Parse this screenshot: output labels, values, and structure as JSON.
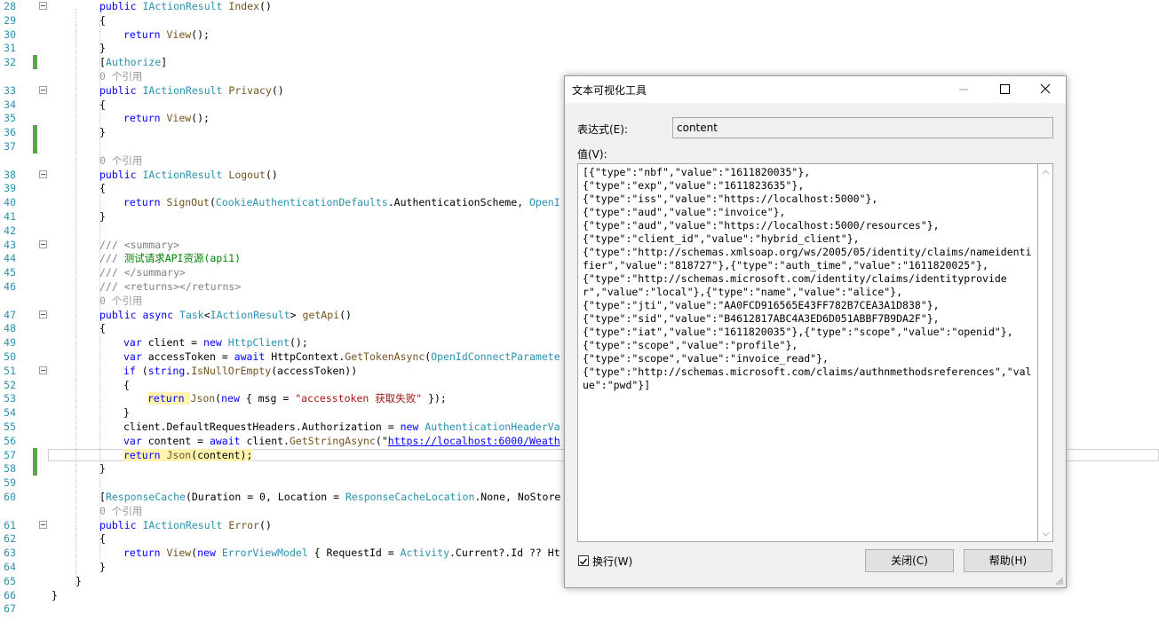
{
  "editor": {
    "lines": [
      {
        "n": "28",
        "fold": true,
        "segs": [
          [
            "kw",
            "public "
          ],
          [
            "ty",
            "IActionResult "
          ],
          [
            "me",
            "Index"
          ],
          [
            "",
            "()"
          ]
        ],
        "ind": 2
      },
      {
        "n": "29",
        "segs": [
          [
            "",
            "{"
          ]
        ],
        "ind": 2
      },
      {
        "n": "30",
        "segs": [
          [
            "kw",
            "return "
          ],
          [
            "me",
            "View"
          ],
          [
            "",
            "();"
          ]
        ],
        "ind": 3
      },
      {
        "n": "31",
        "segs": [
          [
            "",
            "}"
          ]
        ],
        "ind": 2
      },
      {
        "n": "32",
        "chg": true,
        "segs": [
          [
            "",
            "["
          ],
          [
            "ty",
            "Authorize"
          ],
          [
            "",
            "]"
          ]
        ],
        "ind": 2
      },
      {
        "n": "",
        "segs": [
          [
            "ref",
            "0 个引用"
          ]
        ],
        "ind": 2
      },
      {
        "n": "33",
        "fold": true,
        "segs": [
          [
            "kw",
            "public "
          ],
          [
            "ty",
            "IActionResult "
          ],
          [
            "me",
            "Privacy"
          ],
          [
            "",
            "()"
          ]
        ],
        "ind": 2
      },
      {
        "n": "34",
        "segs": [
          [
            "",
            "{"
          ]
        ],
        "ind": 2
      },
      {
        "n": "35",
        "segs": [
          [
            "kw",
            "return "
          ],
          [
            "me",
            "View"
          ],
          [
            "",
            "();"
          ]
        ],
        "ind": 3
      },
      {
        "n": "36",
        "chg": true,
        "segs": [
          [
            "",
            "}"
          ]
        ],
        "ind": 2
      },
      {
        "n": "37",
        "chg": true,
        "segs": [],
        "ind": 2
      },
      {
        "n": "",
        "segs": [
          [
            "ref",
            "0 个引用"
          ]
        ],
        "ind": 2
      },
      {
        "n": "38",
        "fold": true,
        "segs": [
          [
            "kw",
            "public "
          ],
          [
            "ty",
            "IActionResult "
          ],
          [
            "me",
            "Logout"
          ],
          [
            "",
            "()"
          ]
        ],
        "ind": 2
      },
      {
        "n": "39",
        "segs": [
          [
            "",
            "{"
          ]
        ],
        "ind": 2
      },
      {
        "n": "40",
        "segs": [
          [
            "kw",
            "return "
          ],
          [
            "me",
            "SignOut"
          ],
          [
            "",
            "("
          ],
          [
            "ty",
            "CookieAuthenticationDefaults"
          ],
          [
            "",
            ".AuthenticationScheme, "
          ],
          [
            "ty",
            "OpenI"
          ]
        ],
        "ind": 3
      },
      {
        "n": "41",
        "segs": [
          [
            "",
            "}"
          ]
        ],
        "ind": 2
      },
      {
        "n": "42",
        "segs": [],
        "ind": 2
      },
      {
        "n": "43",
        "fold": true,
        "segs": [
          [
            "cg",
            "/// <summary>"
          ]
        ],
        "ind": 2
      },
      {
        "n": "44",
        "segs": [
          [
            "cg",
            "/// "
          ],
          [
            "cm",
            "测试请求API资源(api1)"
          ]
        ],
        "ind": 2
      },
      {
        "n": "45",
        "segs": [
          [
            "cg",
            "/// </summary>"
          ]
        ],
        "ind": 2
      },
      {
        "n": "46",
        "segs": [
          [
            "cg",
            "/// <returns></returns>"
          ]
        ],
        "ind": 2
      },
      {
        "n": "",
        "segs": [
          [
            "ref",
            "0 个引用"
          ]
        ],
        "ind": 2
      },
      {
        "n": "47",
        "fold": true,
        "segs": [
          [
            "kw",
            "public async "
          ],
          [
            "ty",
            "Task"
          ],
          [
            "",
            "<"
          ],
          [
            "ty",
            "IActionResult"
          ],
          [
            "",
            "> "
          ],
          [
            "me",
            "getApi"
          ],
          [
            "",
            "()"
          ]
        ],
        "ind": 2
      },
      {
        "n": "48",
        "segs": [
          [
            "",
            "{"
          ]
        ],
        "ind": 2
      },
      {
        "n": "49",
        "segs": [
          [
            "kw",
            "var "
          ],
          [
            "",
            "client = "
          ],
          [
            "kw",
            "new "
          ],
          [
            "ty",
            "HttpClient"
          ],
          [
            "",
            "();"
          ]
        ],
        "ind": 3
      },
      {
        "n": "50",
        "segs": [
          [
            "kw",
            "var "
          ],
          [
            "",
            "accessToken = "
          ],
          [
            "kw",
            "await "
          ],
          [
            "",
            "HttpContext."
          ],
          [
            "me",
            "GetTokenAsync"
          ],
          [
            "",
            "("
          ],
          [
            "ty",
            "OpenIdConnectParamete"
          ]
        ],
        "ind": 3
      },
      {
        "n": "51",
        "fold": true,
        "segs": [
          [
            "kw",
            "if "
          ],
          [
            "",
            "("
          ],
          [
            "kw",
            "string"
          ],
          [
            "",
            "."
          ],
          [
            "me",
            "IsNullOrEmpty"
          ],
          [
            "",
            "(accessToken))"
          ]
        ],
        "ind": 3
      },
      {
        "n": "52",
        "segs": [
          [
            "",
            "{"
          ]
        ],
        "ind": 3
      },
      {
        "n": "53",
        "segs": [
          [
            "kw hl",
            "return "
          ],
          [
            "me",
            "Json"
          ],
          [
            "",
            "("
          ],
          [
            "kw",
            "new "
          ],
          [
            "",
            "{ msg = "
          ],
          [
            "st",
            "\"accesstoken 获取失败\""
          ],
          [
            "",
            " });"
          ]
        ],
        "ind": 4
      },
      {
        "n": "54",
        "segs": [
          [
            "",
            "}"
          ]
        ],
        "ind": 3
      },
      {
        "n": "55",
        "segs": [
          [
            "",
            "client.DefaultRequestHeaders.Authorization = "
          ],
          [
            "kw",
            "new "
          ],
          [
            "ty",
            "AuthenticationHeaderVa"
          ]
        ],
        "ind": 3
      },
      {
        "n": "56",
        "segs": [
          [
            "kw",
            "var "
          ],
          [
            "",
            "content = "
          ],
          [
            "kw",
            "await "
          ],
          [
            "",
            "client."
          ],
          [
            "me",
            "GetStringAsync"
          ],
          [
            "",
            "(\""
          ],
          [
            "lnk",
            "https://localhost:6000/Weath"
          ]
        ],
        "ind": 3
      },
      {
        "n": "57",
        "chg": true,
        "cur": true,
        "segs": [
          [
            "kw hl",
            "return "
          ],
          [
            "me hl",
            "Json"
          ],
          [
            "hl",
            "(content);"
          ]
        ],
        "ind": 3
      },
      {
        "n": "58",
        "chg": true,
        "segs": [
          [
            "",
            "}"
          ]
        ],
        "ind": 2
      },
      {
        "n": "59",
        "segs": [],
        "ind": 2
      },
      {
        "n": "60",
        "segs": [
          [
            "",
            "["
          ],
          [
            "ty",
            "ResponseCache"
          ],
          [
            "",
            "(Duration = 0, Location = "
          ],
          [
            "ty",
            "ResponseCacheLocation"
          ],
          [
            "",
            ".None, NoStore"
          ]
        ],
        "ind": 2
      },
      {
        "n": "",
        "segs": [
          [
            "ref",
            "0 个引用"
          ]
        ],
        "ind": 2
      },
      {
        "n": "61",
        "fold": true,
        "segs": [
          [
            "kw",
            "public "
          ],
          [
            "ty",
            "IActionResult "
          ],
          [
            "me",
            "Error"
          ],
          [
            "",
            "()"
          ]
        ],
        "ind": 2
      },
      {
        "n": "62",
        "segs": [
          [
            "",
            "{"
          ]
        ],
        "ind": 2
      },
      {
        "n": "63",
        "segs": [
          [
            "kw",
            "return "
          ],
          [
            "me",
            "View"
          ],
          [
            "",
            "("
          ],
          [
            "kw",
            "new "
          ],
          [
            "ty",
            "ErrorViewModel"
          ],
          [
            "",
            " { RequestId = "
          ],
          [
            "ty",
            "Activity"
          ],
          [
            "",
            ".Current?.Id ?? Ht"
          ]
        ],
        "ind": 3
      },
      {
        "n": "64",
        "segs": [
          [
            "",
            "}"
          ]
        ],
        "ind": 2
      },
      {
        "n": "65",
        "segs": [
          [
            "",
            "}"
          ]
        ],
        "ind": 1
      },
      {
        "n": "66",
        "segs": [
          [
            "",
            "}"
          ]
        ],
        "ind": 0
      },
      {
        "n": "67",
        "segs": [],
        "ind": 0
      }
    ]
  },
  "dialog": {
    "title": "文本可视化工具",
    "expr_label": "表达式(E):",
    "expr_value": "content",
    "value_label": "值(V):",
    "value_text": "[{\"type\":\"nbf\",\"value\":\"1611820035\"},\n{\"type\":\"exp\",\"value\":\"1611823635\"},\n{\"type\":\"iss\",\"value\":\"https://localhost:5000\"},\n{\"type\":\"aud\",\"value\":\"invoice\"},\n{\"type\":\"aud\",\"value\":\"https://localhost:5000/resources\"},\n{\"type\":\"client_id\",\"value\":\"hybrid_client\"},\n{\"type\":\"http://schemas.xmlsoap.org/ws/2005/05/identity/claims/nameidentifier\",\"value\":\"818727\"},{\"type\":\"auth_time\",\"value\":\"1611820025\"},\n{\"type\":\"http://schemas.microsoft.com/identity/claims/identityprovider\",\"value\":\"local\"},{\"type\":\"name\",\"value\":\"alice\"},\n{\"type\":\"jti\",\"value\":\"AA0FCD916565E43FF782B7CEA3A1D838\"},\n{\"type\":\"sid\",\"value\":\"B4612817ABC4A3ED6D051ABBF7B9DA2F\"},\n{\"type\":\"iat\",\"value\":\"1611820035\"},{\"type\":\"scope\",\"value\":\"openid\"},\n{\"type\":\"scope\",\"value\":\"profile\"},\n{\"type\":\"scope\",\"value\":\"invoice_read\"},\n{\"type\":\"http://schemas.microsoft.com/claims/authnmethodsreferences\",\"value\":\"pwd\"}]",
    "wrap_label": "换行(W)",
    "close_button": "关闭(C)",
    "help_button": "帮助(H)",
    "wrap_checked": true
  }
}
